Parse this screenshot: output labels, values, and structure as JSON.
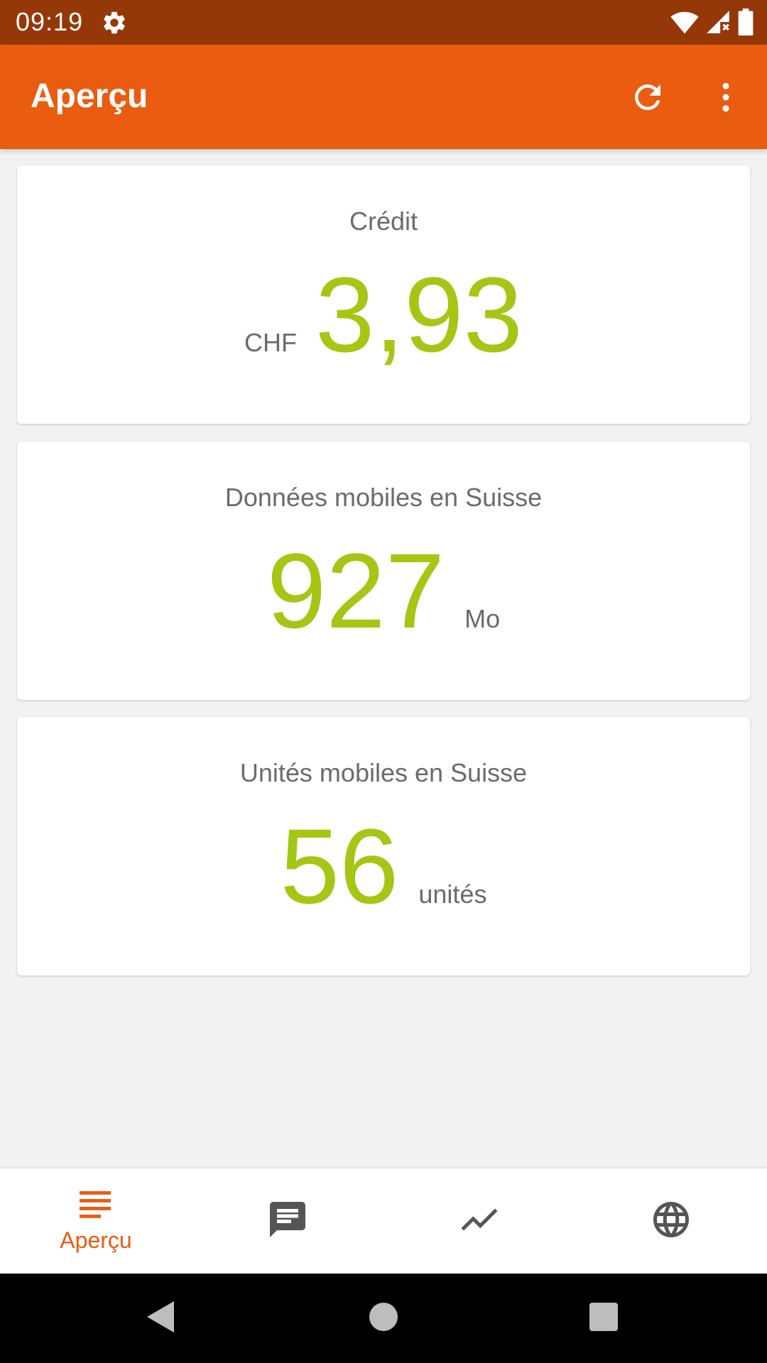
{
  "status_bar": {
    "time": "09:19",
    "icons": [
      "settings-gear-icon",
      "wifi-icon",
      "cell-signal-icon",
      "battery-icon"
    ]
  },
  "app_bar": {
    "title": "Aperçu",
    "actions": [
      "refresh-icon",
      "more-vert-icon"
    ],
    "color": "#ea5c0f"
  },
  "cards": {
    "credit": {
      "title": "Crédit",
      "unit": "CHF",
      "value": "3,93"
    },
    "data": {
      "title": "Données mobiles en Suisse",
      "value": "927",
      "unit": "Mo"
    },
    "units": {
      "title": "Unités mobiles en Suisse",
      "value": "56",
      "unit": "unités"
    }
  },
  "bottom_nav": {
    "items": [
      {
        "label": "Aperçu",
        "icon": "list-icon",
        "active": true
      },
      {
        "label": "",
        "icon": "message-icon",
        "active": false
      },
      {
        "label": "",
        "icon": "trending-icon",
        "active": false
      },
      {
        "label": "",
        "icon": "globe-icon",
        "active": false
      }
    ]
  },
  "colors": {
    "accent": "#ea5c0f",
    "status_bar": "#953807",
    "value_green": "#a5c615",
    "label_gray": "#6b6b6b"
  }
}
